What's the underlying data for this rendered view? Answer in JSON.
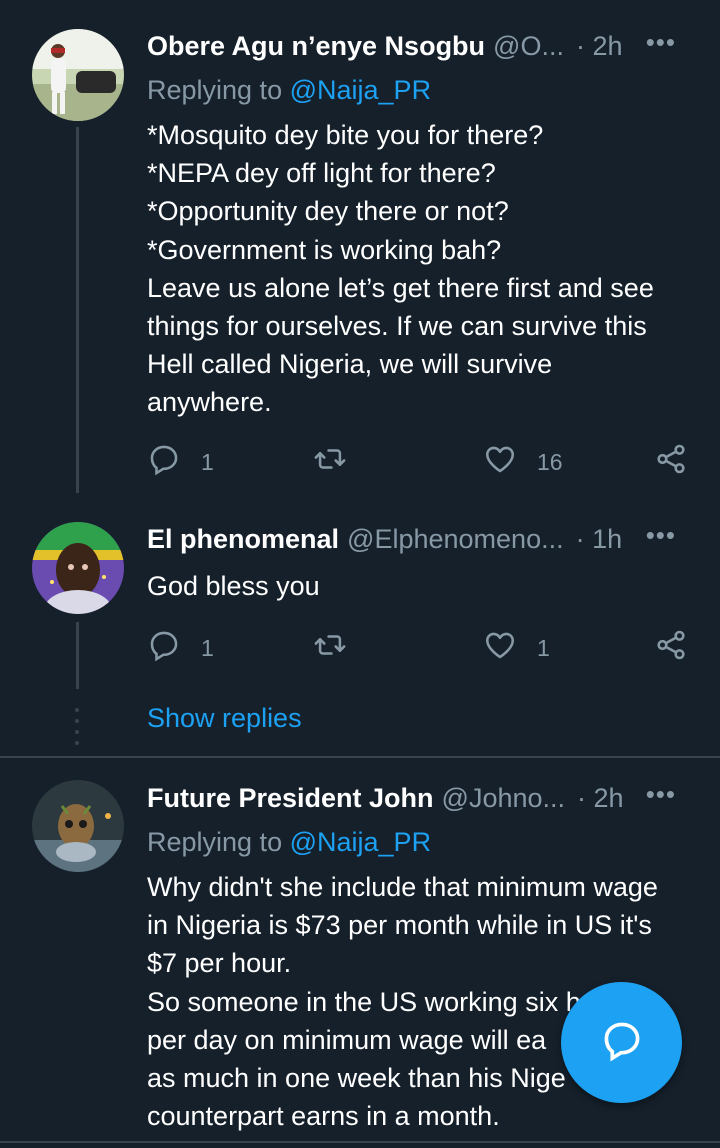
{
  "tweets": [
    {
      "name": "Obere Agu n’enye Nsogbu",
      "handle": "@O...",
      "time": "· 2h",
      "more": "•••",
      "replying_prefix": "Replying to",
      "replying_to": "@Naija_PR",
      "lines": [
        "*Mosquito dey bite you for there?",
        "*NEPA dey off light for there?",
        "*Opportunity dey there or not?",
        "*Government is working bah?",
        "Leave us alone let’s get there first and see",
        "things for ourselves. If we can survive this",
        "Hell called Nigeria, we will survive",
        "anywhere."
      ],
      "reply_count": "1",
      "retweet_count": "",
      "like_count": "16"
    },
    {
      "name": "El phenomenal",
      "handle": "@Elphenomeno...",
      "time": "· 1h",
      "more": "•••",
      "lines": [
        "God bless you"
      ],
      "reply_count": "1",
      "retweet_count": "",
      "like_count": "1"
    },
    {
      "name": "Future President John",
      "handle": "@Johno...",
      "time": "· 2h",
      "more": "•••",
      "replying_prefix": "Replying to",
      "replying_to": "@Naija_PR",
      "lines": [
        "Why didn't she include that minimum wage",
        "in Nigeria is $73 per month while in US it's",
        "$7 per hour.",
        "So someone in the US working six h",
        "per day on minimum wage will ea",
        "as much in one week than his Nige",
        "counterpart earns in a month."
      ]
    }
  ],
  "show_replies": "Show replies",
  "colors": {
    "background": "#15202b",
    "accent": "#1da1f2",
    "secondary_text": "#8899a6",
    "divider": "#38444d"
  },
  "icons": {
    "reply": "reply-icon",
    "retweet": "retweet-icon",
    "like": "heart-icon",
    "share": "share-icon",
    "compose": "compose-reply-icon"
  }
}
